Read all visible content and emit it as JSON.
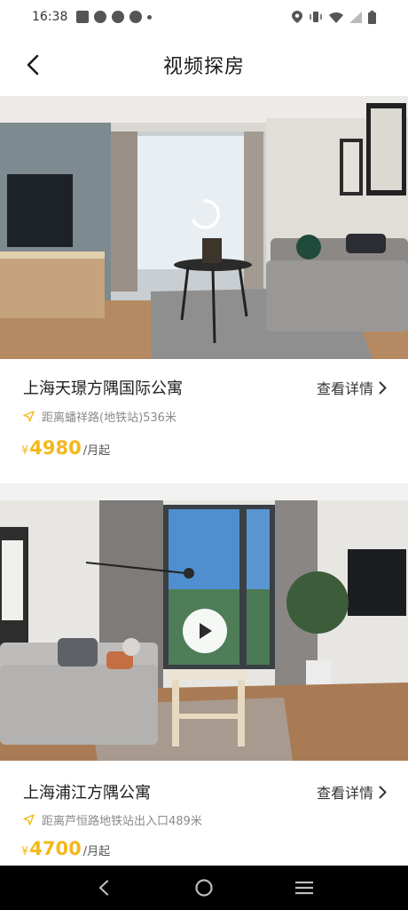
{
  "status_bar": {
    "time": "16:38",
    "left_icons": [
      "mail-icon",
      "app-icon",
      "app-icon",
      "app-icon",
      "dot-icon"
    ],
    "right_icons": [
      "location-icon",
      "vibrate-icon",
      "wifi-icon",
      "signal-icon",
      "battery-icon"
    ]
  },
  "header": {
    "title": "视频探房",
    "back_icon": "chevron-left-icon"
  },
  "listings": [
    {
      "title": "上海天璟方隅国际公寓",
      "detail_label": "查看详情",
      "location": "距离蟠祥路(地铁站)536米",
      "price_currency": "¥",
      "price": "4980",
      "price_unit": "/月起",
      "media_state": "loading"
    },
    {
      "title": "上海浦江方隅公寓",
      "detail_label": "查看详情",
      "location": "距离芦恒路地铁站出入口489米",
      "price_currency": "¥",
      "price": "4700",
      "price_unit": "/月起",
      "media_state": "paused"
    }
  ],
  "colors": {
    "price": "#f3b81b",
    "nav_bg": "#000000",
    "divider": "#f2f2f2"
  },
  "system_nav": [
    "back-icon",
    "home-icon",
    "recents-icon"
  ]
}
